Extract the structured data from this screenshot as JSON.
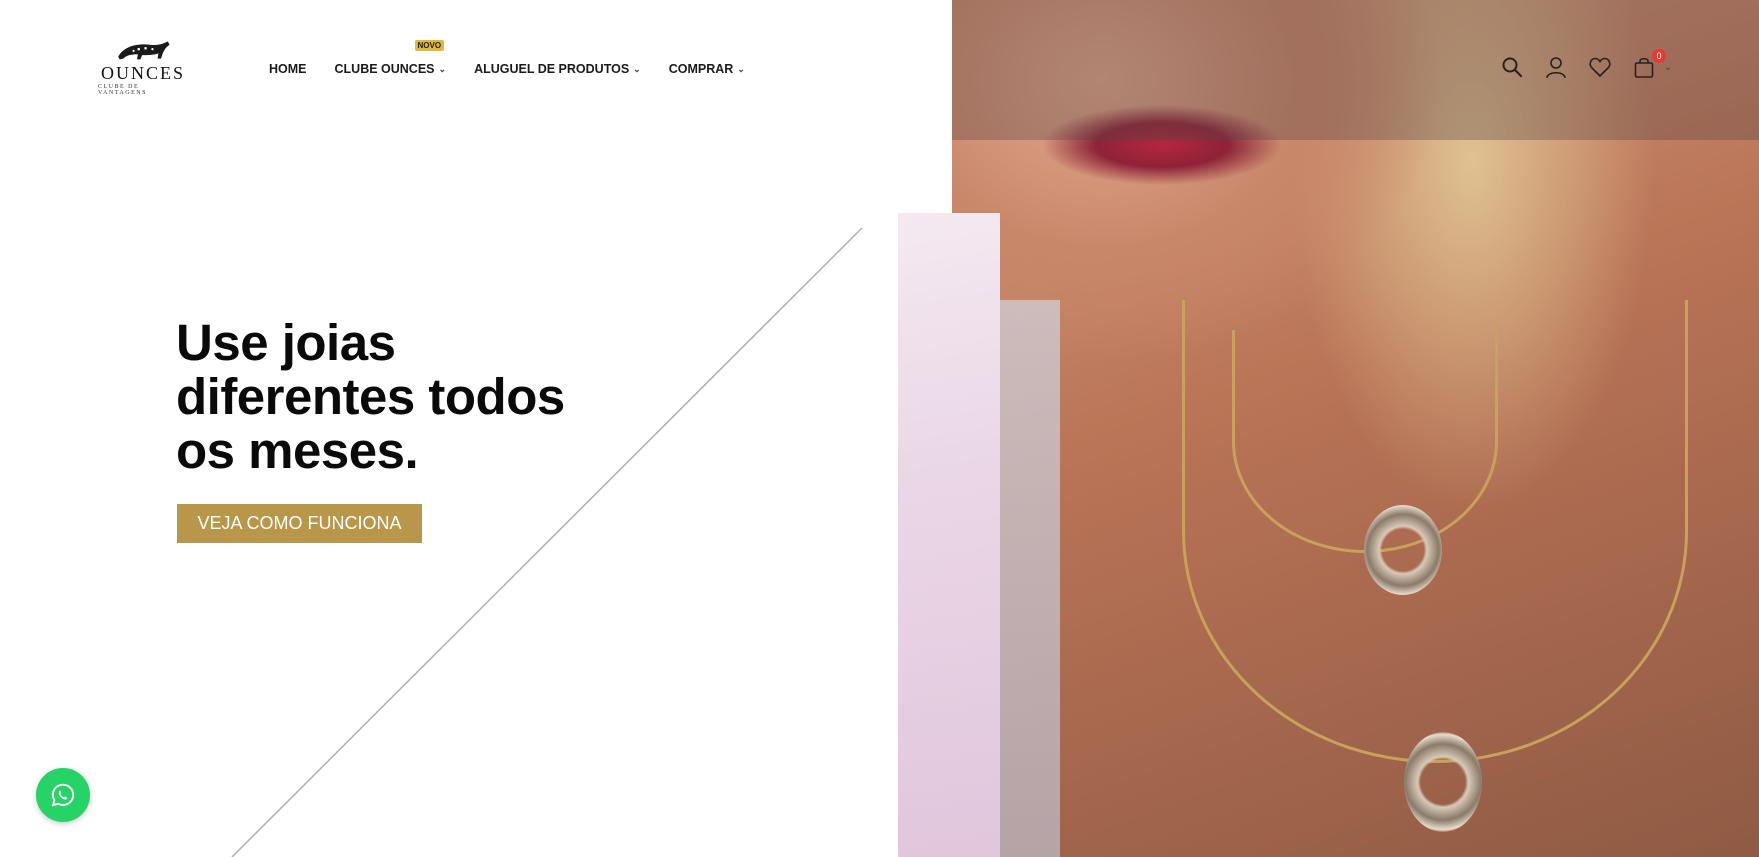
{
  "logo": {
    "brand": "OUNCES",
    "tagline": "CLUBE DE VANTAGENS"
  },
  "nav": {
    "items": [
      {
        "label": "HOME",
        "has_dropdown": false
      },
      {
        "label": "CLUBE OUNCES",
        "has_dropdown": true,
        "badge": "NOVO"
      },
      {
        "label": "ALUGUEL DE PRODUTOS",
        "has_dropdown": true
      },
      {
        "label": "COMPRAR",
        "has_dropdown": true
      }
    ]
  },
  "header_icons": {
    "search": "search-icon",
    "account": "user-icon",
    "wishlist": "heart-icon",
    "cart": "shopping-bag-icon",
    "cart_count": "0"
  },
  "hero": {
    "title": "Use joias diferentes todos os meses.",
    "cta_label": "VEJA COMO FUNCIONA"
  },
  "colors": {
    "accent": "#b8964a",
    "badge": "#e0b83e",
    "whatsapp": "#25d366",
    "cart_badge": "#e53935"
  },
  "floating": {
    "whatsapp_icon": "whatsapp-icon"
  }
}
